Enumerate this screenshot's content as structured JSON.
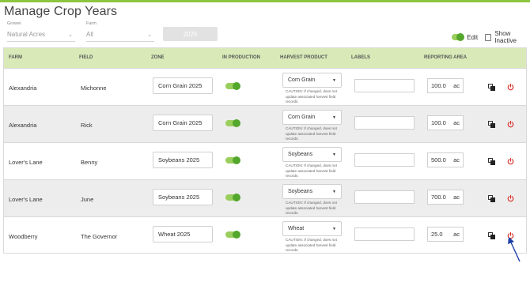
{
  "page": {
    "title": "Manage Crop Years"
  },
  "filters": {
    "grower": {
      "label": "Grower",
      "value": "Natural Acres"
    },
    "farm": {
      "label": "Farm",
      "value": "All"
    },
    "year": {
      "value": "2025"
    }
  },
  "controls": {
    "edit_label": "Edit",
    "show_inactive_label": "Show Inactive"
  },
  "colors": {
    "accent": "#8cc63f",
    "header_bg": "#d9eab8",
    "toggle_knob": "#53a72c",
    "power_red": "#d9312b",
    "arrow": "#1f3fa8"
  },
  "table": {
    "headers": {
      "farm": "FARM",
      "field": "FIELD",
      "zone": "ZONE",
      "in_production": "IN PRODUCTION",
      "harvest_product": "HARVEST PRODUCT",
      "labels": "LABELS",
      "reporting_area": "REPORTING AREA"
    },
    "caution_text": "CAUTION: If changed, does not update associated harvest field records.",
    "unit": "ac",
    "rows": [
      {
        "farm": "Alexandria",
        "field": "Michonne",
        "zone": "Corn Grain 2025",
        "harvest_product": "Corn Grain",
        "area": "100.0"
      },
      {
        "farm": "Alexandria",
        "field": "Rick",
        "zone": "Corn Grain 2025",
        "harvest_product": "Corn Grain",
        "area": "100.0"
      },
      {
        "farm": "Lover's Lane",
        "field": "Benny",
        "zone": "Soybeans 2025",
        "harvest_product": "Soybeans",
        "area": "500.0"
      },
      {
        "farm": "Lover's Lane",
        "field": "June",
        "zone": "Soybeans 2025",
        "harvest_product": "Soybeans",
        "area": "700.0"
      },
      {
        "farm": "Woodberry",
        "field": "The Governor",
        "zone": "Wheat 2025",
        "harvest_product": "Wheat",
        "area": "25.0"
      }
    ]
  }
}
